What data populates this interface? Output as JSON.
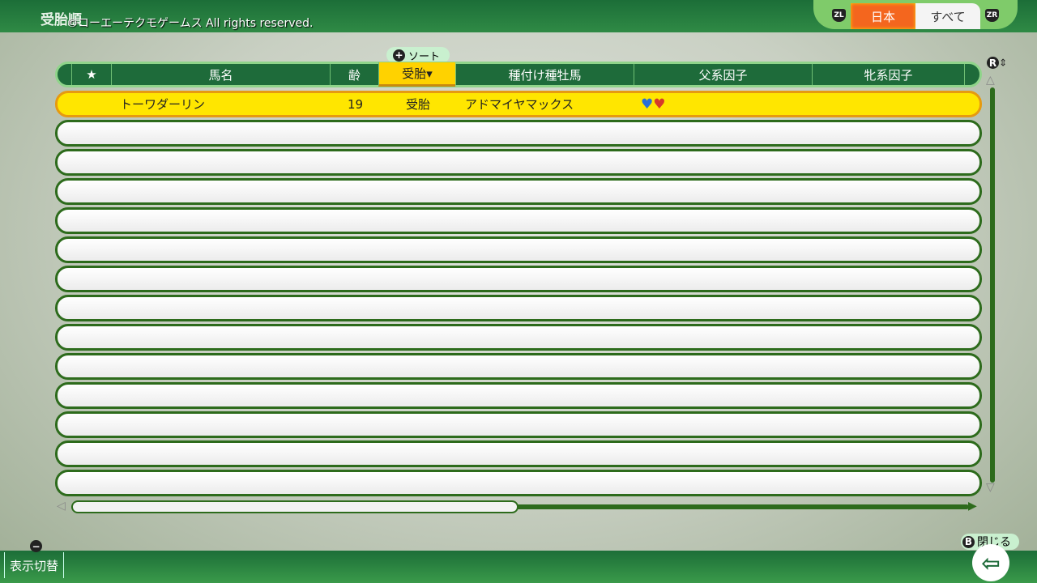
{
  "top": {
    "title": "受胎順",
    "copyright": "©コーエーテクモゲームス All rights reserved.",
    "tabs": [
      "日本",
      "すべて"
    ],
    "left_key": "ZL",
    "right_key": "ZR"
  },
  "sort": {
    "key": "+",
    "label": "ソート"
  },
  "columns": [
    "★",
    "馬名",
    "齢",
    "受胎▾",
    "種付け種牡馬",
    "父系因子",
    "牝系因子"
  ],
  "rows": [
    {
      "name": "トーワダーリン",
      "age": "19",
      "status": "受胎",
      "sire": "アドマイヤマックス",
      "factors": [
        "blue",
        "red"
      ]
    },
    {},
    {},
    {},
    {},
    {},
    {},
    {},
    {},
    {},
    {},
    {},
    {},
    {}
  ],
  "scroll_key": "R",
  "horizontal_scroll": 0.48,
  "bottom": {
    "display_key": "−",
    "display_label": "表示切替",
    "close_key": "B",
    "close_label": "閉じる"
  },
  "colors": {
    "selected_row": "#ffe600",
    "sorted_col": "#ffd200",
    "active_tab": "#f4661e",
    "factor_blue": "#2a6fd6",
    "factor_red": "#d63a2a"
  }
}
